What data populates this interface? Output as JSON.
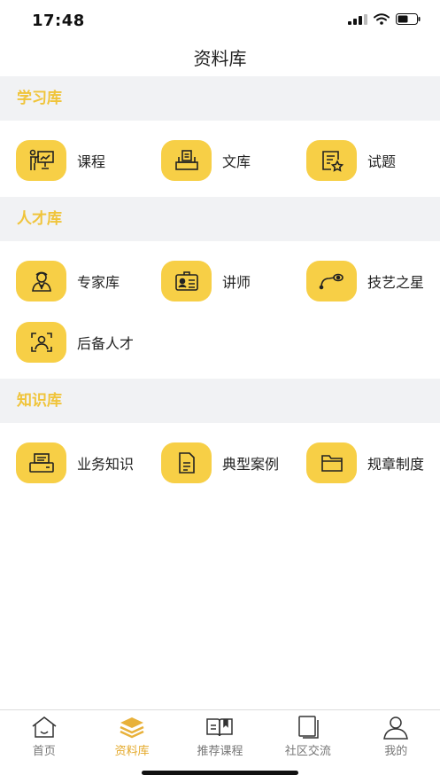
{
  "status": {
    "time": "17:48"
  },
  "nav": {
    "title": "资料库"
  },
  "accent": "#f7cf46",
  "sections": [
    {
      "title": "学习库",
      "rows": [
        [
          {
            "label": "课程",
            "icon": "teacher-icon"
          },
          {
            "label": "文库",
            "icon": "document-stack-icon"
          },
          {
            "label": "试题",
            "icon": "exam-icon"
          }
        ]
      ]
    },
    {
      "title": "人才库",
      "rows": [
        [
          {
            "label": "专家库",
            "icon": "expert-icon"
          },
          {
            "label": "讲师",
            "icon": "id-card-icon"
          },
          {
            "label": "技艺之星",
            "icon": "tool-icon"
          }
        ],
        [
          {
            "label": "后备人才",
            "icon": "reserve-talent-icon"
          }
        ]
      ]
    },
    {
      "title": "知识库",
      "rows": [
        [
          {
            "label": "业务知识",
            "icon": "printer-icon"
          },
          {
            "label": "典型案例",
            "icon": "file-icon"
          },
          {
            "label": "规章制度",
            "icon": "folder-icon"
          }
        ]
      ]
    }
  ],
  "tabs": [
    {
      "label": "首页",
      "icon": "home-icon",
      "active": false
    },
    {
      "label": "资料库",
      "icon": "layers-icon",
      "active": true
    },
    {
      "label": "推荐课程",
      "icon": "book-icon",
      "active": false
    },
    {
      "label": "社区交流",
      "icon": "notebook-icon",
      "active": false
    },
    {
      "label": "我的",
      "icon": "user-icon",
      "active": false
    }
  ]
}
